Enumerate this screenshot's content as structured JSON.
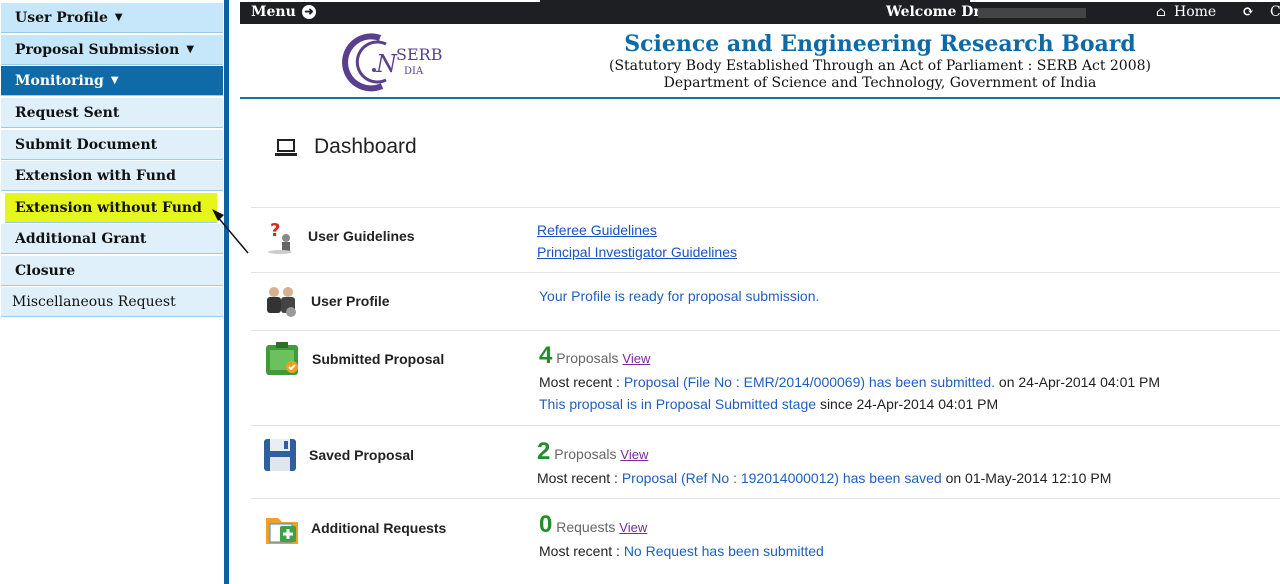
{
  "sidebar": {
    "items": [
      {
        "label": "User Profile"
      },
      {
        "label": "Proposal Submission"
      },
      {
        "label": "Monitoring"
      },
      {
        "label": "Request Sent"
      },
      {
        "label": "Submit Document"
      },
      {
        "label": "Extension with Fund"
      },
      {
        "label": "Extension without Fund"
      },
      {
        "label": "Additional Grant"
      },
      {
        "label": "Closure"
      },
      {
        "label": "Miscellaneous Request"
      }
    ]
  },
  "topbar": {
    "menu_label": "Menu",
    "welcome": "Welcome Dr.",
    "home_label": "Home",
    "extra": "C"
  },
  "header": {
    "logo_text_1": "SERB",
    "logo_text_2": "DIA",
    "title": "Science and Engineering Research Board",
    "subtitle1": "(Statutory Body Established Through an Act of Parliament : SERB Act 2008)",
    "subtitle2": "Department of Science and Technology, Government of India"
  },
  "dashboard": {
    "title": "Dashboard",
    "guidelines": {
      "label": "User Guidelines",
      "links": [
        "Referee Guidelines",
        "Principal Investigator Guidelines"
      ]
    },
    "profile": {
      "label": "User Profile",
      "message": "Your Profile is ready for proposal submission."
    },
    "submitted": {
      "label": "Submitted Proposal",
      "count": "4",
      "unit": "Proposals",
      "view": "View",
      "recent_prefix": "Most recent :",
      "recent_link": "Proposal (File No : EMR/2014/000069) has been submitted.",
      "recent_suffix": "on 24-Apr-2014 04:01 PM",
      "stage_text": "This proposal is in Proposal Submitted stage",
      "stage_suffix": "since 24-Apr-2014 04:01 PM"
    },
    "saved": {
      "label": "Saved Proposal",
      "count": "2",
      "unit": "Proposals",
      "view": "View",
      "recent_prefix": "Most recent :",
      "recent_link": "Proposal (Ref No : 192014000012) has been saved",
      "recent_suffix": "on 01-May-2014 12:10 PM"
    },
    "additional": {
      "label": "Additional Requests",
      "count": "0",
      "unit": "Requests",
      "view": "View",
      "recent_prefix": "Most recent :",
      "recent_link": "No Request has been submitted"
    }
  }
}
